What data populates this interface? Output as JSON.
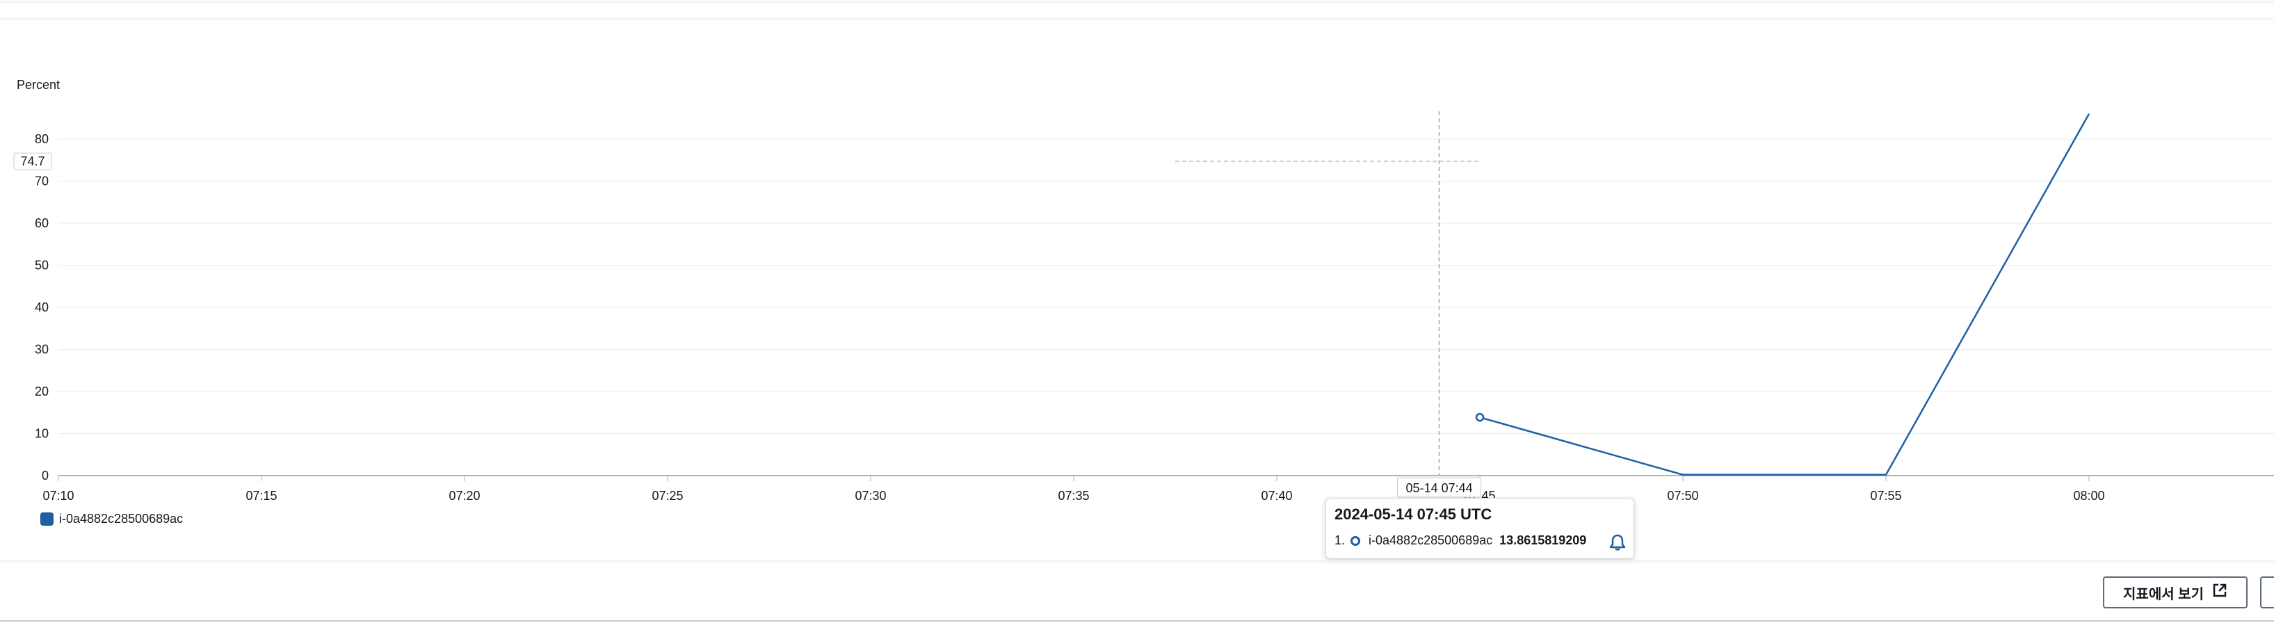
{
  "chart_data": {
    "type": "line",
    "ylabel": "Percent",
    "yticks": [
      0,
      10,
      20,
      30,
      40,
      50,
      60,
      70,
      80
    ],
    "ylim": [
      0,
      86
    ],
    "x_range": [
      "07:10",
      "08:05"
    ],
    "xticks": [
      "07:10",
      "07:15",
      "07:20",
      "07:25",
      "07:30",
      "07:35",
      "07:40",
      "07:45",
      "07:50",
      "07:55",
      "08:00"
    ],
    "grid": true,
    "legend_position": "bottom-left",
    "series": [
      {
        "name": "i-0a4882c28500689ac",
        "color": "#1f5fa6",
        "x": [
          "07:45",
          "07:50",
          "07:55",
          "08:00"
        ],
        "y": [
          13.86,
          0.2,
          0.2,
          86
        ]
      }
    ],
    "crosshair": {
      "x_label": "05-14 07:44",
      "y_label": "74.7"
    },
    "tooltip": {
      "title": "2024-05-14 07:45 UTC",
      "index": "1.",
      "series": "i-0a4882c28500689ac",
      "value": "13.8615819209"
    }
  },
  "footer": {
    "view_in_metrics_label": "지표에서 보기"
  }
}
